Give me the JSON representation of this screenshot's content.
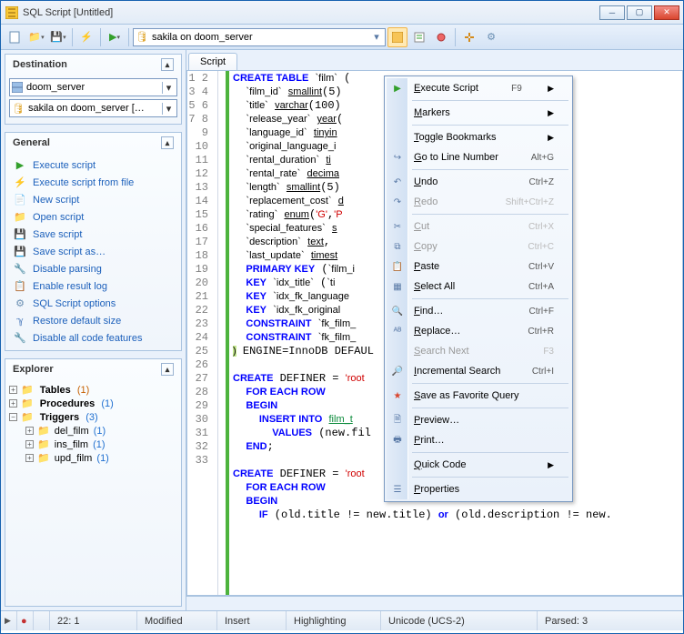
{
  "window": {
    "title": "SQL Script [Untitled]"
  },
  "toolbar": {
    "connection": "sakila on doom_server"
  },
  "sidebar": {
    "destination": {
      "title": "Destination",
      "server": "doom_server",
      "db": "sakila on doom_server […"
    },
    "general": {
      "title": "General",
      "items": [
        "Execute script",
        "Execute script from file",
        "New script",
        "Open script",
        "Save script",
        "Save script as…",
        "Disable parsing",
        "Enable result log",
        "SQL Script options",
        "Restore default size",
        "Disable all code features"
      ]
    },
    "explorer": {
      "title": "Explorer",
      "tables": {
        "label": "Tables",
        "count": "(1)"
      },
      "procedures": {
        "label": "Procedures",
        "count": "(1)"
      },
      "triggers": {
        "label": "Triggers",
        "count": "(3)",
        "children": [
          {
            "label": "del_film",
            "count": "(1)"
          },
          {
            "label": "ins_film",
            "count": "(1)"
          },
          {
            "label": "upd_film",
            "count": "(1)"
          }
        ]
      }
    }
  },
  "editor": {
    "tab": "Script",
    "code_html": "<span class='kw'>CREATE TABLE</span> <span class='st'>`film`</span> (\n  <span class='st'>`film_id`</span> <span class='id'>smallint</span>(5)               INCREMENT,\n  <span class='st'>`title`</span> <span class='id'>varchar</span>(100)\n  <span class='st'>`release_year`</span> <span class='id'>year</span>(\n  <span class='st'>`language_id`</span> <span class='id'>tinyin</span>\n  <span class='st'>`original_language_i</span>               FAULT <span class='kw'>NULL</span>,\n  <span class='st'>`rental_duration`</span> <span class='id'>ti</span>               LL <span class='kw'>DEFAULT</span> <span class='str'>'3</span>\n  <span class='st'>`rental_rate`</span> <span class='id'>decima</span>               <span class='str'>4.99'</span>,\n  <span class='st'>`length`</span> <span class='id'>smallint</span>(5)\n  <span class='st'>`replacement_cost`</span> <span class='id'>d</span>               ULT <span class='str'>'19.99'</span>,\n  <span class='st'>`rating`</span> <span class='id'>enum</span>(<span class='str'>'G'</span>,<span class='str'>'P</span>               EFAULT <span class='str'>'G'</span>,\n  <span class='st'>`special_features`</span> <span class='id'>s</span>               es<span class='str'>'</span>,<span class='str'>'Deleted</span>\n  <span class='st'>`description`</span> <span class='id'>text</span>,\n  <span class='st'>`last_update`</span> <span class='id'>timest</span>               ENT_TIMESTAM\n  <span class='kw'>PRIMARY KEY</span> (<span class='st'>`film_i</span>\n  <span class='kw'>KEY</span> <span class='st'>`idx_title`</span> (<span class='st'>`ti</span>\n  <span class='kw'>KEY</span> <span class='st'>`idx_fk_language</span>\n  <span class='kw'>KEY</span> <span class='st'>`idx_fk_original</span>               language_id<span class='st'>`</span>\n  <span class='kw'>CONSTRAINT</span> <span class='st'>`fk_film_</span>               anguage_id<span class='st'>`</span>)\n  <span class='kw'>CONSTRAINT</span> <span class='st'>`fk_film_</span>               N <span class='kw'>KEY</span> (<span class='st'>`orig</span>\n<span style='background:#c3e88d'>)</span> ENGINE=InnoDB DEFAUL               NGTH=192 PACK\n\n<span class='kw'>CREATE</span> DEFINER = <span class='str'>'root</span>               s_film<span class='st'>`</span> AFTE\n  <span class='kw'>FOR EACH ROW</span>\n  <span class='kw'>BEGIN</span>\n    <span class='kw'>INSERT INTO</span> <span style='color:#0a8a3a;text-decoration:underline'>film_t</span>               ription)\n      <span class='kw'>VALUES</span> (new.fil               scription);\n  <span class='kw'>END</span>;\n\n<span class='kw'>CREATE</span> DEFINER = <span class='str'>'root</span>               d_film<span class='st'>`</span> AFTE\n  <span class='kw'>FOR EACH ROW</span>\n  <span class='kw'>BEGIN</span>\n    <span class='kw'>IF</span> (old.title != new.title) <span class='kw'>or</span> (old.description != new.",
    "line_start": 1
  },
  "context_menu": [
    {
      "label": "Execute Script",
      "kb": "F9",
      "arrow": true,
      "icon": "play"
    },
    {
      "sep": true
    },
    {
      "label": "Markers",
      "arrow": true
    },
    {
      "sep": true
    },
    {
      "label": "Toggle Bookmarks",
      "arrow": true
    },
    {
      "label": "Go to Line Number",
      "kb": "Alt+G",
      "icon": "goto"
    },
    {
      "sep": true
    },
    {
      "label": "Undo",
      "kb": "Ctrl+Z",
      "icon": "undo"
    },
    {
      "label": "Redo",
      "kb": "Shift+Ctrl+Z",
      "disabled": true,
      "icon": "redo"
    },
    {
      "sep": true
    },
    {
      "label": "Cut",
      "kb": "Ctrl+X",
      "disabled": true,
      "icon": "cut"
    },
    {
      "label": "Copy",
      "kb": "Ctrl+C",
      "disabled": true,
      "icon": "copy"
    },
    {
      "label": "Paste",
      "kb": "Ctrl+V",
      "icon": "paste"
    },
    {
      "label": "Select All",
      "kb": "Ctrl+A",
      "icon": "selectall"
    },
    {
      "sep": true
    },
    {
      "label": "Find…",
      "kb": "Ctrl+F",
      "icon": "find"
    },
    {
      "label": "Replace…",
      "kb": "Ctrl+R",
      "icon": "replace"
    },
    {
      "label": "Search Next",
      "kb": "F3",
      "disabled": true
    },
    {
      "label": "Incremental Search",
      "kb": "Ctrl+I",
      "icon": "isearch"
    },
    {
      "sep": true
    },
    {
      "label": "Save as Favorite Query",
      "icon": "star"
    },
    {
      "sep": true
    },
    {
      "label": "Preview…",
      "icon": "preview"
    },
    {
      "label": "Print…",
      "icon": "print"
    },
    {
      "sep": true
    },
    {
      "label": "Quick Code",
      "arrow": true
    },
    {
      "sep": true
    },
    {
      "label": "Properties",
      "icon": "props"
    }
  ],
  "statusbar": {
    "rec": "●",
    "pos": "22:   1",
    "state": "Modified",
    "mode": "Insert",
    "hl": "Highlighting",
    "enc": "Unicode (UCS-2)",
    "parsed": "Parsed: 3"
  },
  "icons": {
    "db": "🛢",
    "folder": "📁",
    "disk": "💾",
    "bolt": "⚡",
    "play": "▶",
    "page": "📄",
    "gear": "⚙",
    "rec": "●"
  }
}
